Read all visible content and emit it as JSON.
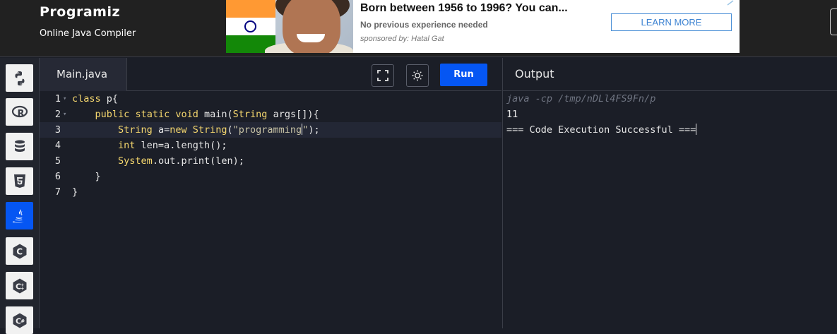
{
  "header": {
    "logo_text": "Programiz",
    "subtitle": "Online Java Compiler"
  },
  "ad": {
    "title": "Born between 1956 to 1996? You can...",
    "description": "No previous experience needed",
    "sponsor": "sponsored by: Hatal Gat",
    "cta_label": "LEARN MORE"
  },
  "sidebar": {
    "items": [
      {
        "name": "python",
        "icon": "python-icon",
        "active": false
      },
      {
        "name": "r",
        "icon": "r-icon",
        "active": false
      },
      {
        "name": "sql",
        "icon": "database-icon",
        "active": false
      },
      {
        "name": "html",
        "icon": "html5-icon",
        "active": false
      },
      {
        "name": "java",
        "icon": "java-icon",
        "active": true
      },
      {
        "name": "c",
        "icon": "c-icon",
        "active": false
      },
      {
        "name": "cpp",
        "icon": "cpp-icon",
        "active": false
      },
      {
        "name": "csharp",
        "icon": "csharp-icon",
        "active": false
      }
    ]
  },
  "editor": {
    "tab_label": "Main.java",
    "run_label": "Run",
    "active_line": 3,
    "lines": [
      {
        "num": "1",
        "text": "class p{"
      },
      {
        "num": "2",
        "text": "    public static void main(String args[]){"
      },
      {
        "num": "3",
        "text": "        String a=new String(\"programming\");"
      },
      {
        "num": "4",
        "text": "        int len=a.length();"
      },
      {
        "num": "5",
        "text": "        System.out.print(len);"
      },
      {
        "num": "6",
        "text": "    }"
      },
      {
        "num": "7",
        "text": "}"
      }
    ]
  },
  "output": {
    "title": "Output",
    "command": "java -cp /tmp/nDLl4FS9Fn/p",
    "result": "11",
    "status": "=== Code Execution Successful ==="
  },
  "colors": {
    "accent": "#0556f3",
    "background": "#1b1e27",
    "header_bg": "#212121",
    "keyword": "#f5d76e"
  }
}
